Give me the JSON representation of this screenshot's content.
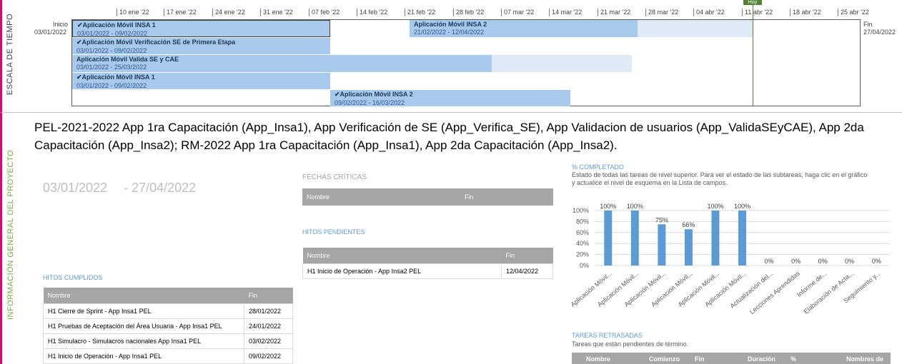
{
  "timeline": {
    "side_label": "ESCALA DE TIEMPO",
    "ticks": [
      "10 ene '22",
      "17 ene '22",
      "24 ene '22",
      "31 ene '22",
      "07 feb '22",
      "14 feb '22",
      "21 feb '22",
      "28 feb '22",
      "07 mar '22",
      "14 mar '22",
      "21 mar '22",
      "28 mar '22",
      "04 abr '22",
      "11 abr '22",
      "18 abr '22",
      "25 abr '22"
    ],
    "start_label": "Inicio",
    "start_date": "03/01/2022",
    "end_label": "Fin",
    "end_date": "27/04/2022",
    "today_label": "Hoy",
    "bars": [
      {
        "name": "✔Aplicación Móvil INSA 1",
        "dates": "03/01/2022 - 09/02/2022"
      },
      {
        "name": "Aplicación Móvil INSA 2",
        "dates": "21/02/2022 - 12/04/2022"
      },
      {
        "name": "✔Aplicación Móvil Verificación SE de Primera Etapa",
        "dates": "03/01/2022 - 09/02/2022"
      },
      {
        "name": "Aplicación Móvil Valida SE y CAE",
        "dates": "03/01/2022 - 25/03/2022"
      },
      {
        "name": "✔Aplicación Móvil INSA 1",
        "dates": "03/01/2022 - 09/02/2022"
      },
      {
        "name": "✔Aplicación Móvil INSA 2",
        "dates": "09/02/2022 - 16/03/2022"
      }
    ]
  },
  "info": {
    "side_label": "INFORMACIÓN GENERAL DEL PROYECTO",
    "description": "PEL-2021-2022 App 1ra Capacitación (App_Insa1), App Verificación de SE (App_Verifica_SE), App Validacion de usuarios (App_ValidaSEyCAE), App 2da Capacitación (App_Insa2); RM-2022 App 1ra Capacitación (App_Insa1), App 2da Capacitación (App_Insa2).",
    "date_start": "03/01/2022",
    "date_end": "- 27/04/2022"
  },
  "fechas_criticas": {
    "title": "FECHAS CRÍTICAS",
    "col_name": "Nombre",
    "col_end": "Fin"
  },
  "hitos_pendientes": {
    "title": "HITOS PENDIENTES",
    "col_name": "Nombre",
    "col_end": "Fin",
    "rows": [
      {
        "name": "H1 Inicio de Operación - App Insa2 PEL",
        "end": "12/04/2022"
      }
    ]
  },
  "hitos_cumplidos": {
    "title": "HITOS CUMPLIDOS",
    "col_name": "Nombre",
    "col_end": "Fin",
    "rows": [
      {
        "name": "H1 Cierre de Sprint - App Insa1 PEL",
        "end": "28/01/2022"
      },
      {
        "name": "H1 Pruebas de Aceptación del Área Usuaria - App Insa1 PEL",
        "end": "24/01/2022"
      },
      {
        "name": "H1 Simulacro - Simulacros nacionales App Insa1 PEL",
        "end": "03/02/2022"
      },
      {
        "name": "H1 Inicio de Operación - App Insa1 PEL",
        "end": "09/02/2022"
      }
    ]
  },
  "completado": {
    "title": "% COMPLETADO",
    "subtitle": "Estado de todas las tareas de nivel superior. Para ver el estado de las subtareas, haga clic en el gráfico y actualice el nivel de esquema en la Lista de campos."
  },
  "chart_data": {
    "type": "bar",
    "categories": [
      "Aplicación Móvil...",
      "Aplicación Móvil...",
      "Aplicación Móvil...",
      "Aplicación Móvil...",
      "Aplicación Móvil...",
      "Aplicación Móvil...",
      "Actualización del...",
      "Lecciones Aprendidas",
      "Informe de...",
      "Elaboración de Acta...",
      "Seguimiento y..."
    ],
    "values": [
      100,
      100,
      75,
      66,
      100,
      100,
      0,
      0,
      0,
      0,
      0
    ],
    "data_labels": [
      "100%",
      "100%",
      "75%",
      "66%",
      "100%",
      "100%",
      "0%",
      "0%",
      "0%",
      "0%",
      "0%"
    ],
    "y_ticks": [
      "0%",
      "20%",
      "40%",
      "60%",
      "80%",
      "100%"
    ],
    "ylim": [
      0,
      100
    ],
    "bar_color": "#5b9bd5",
    "grid": true
  },
  "tareas_retrasadas": {
    "title": "TAREAS RETRASADAS",
    "subtitle": "Tareas que están pendientes de término.",
    "columns": [
      "Nombre",
      "Comienzo",
      "Fin",
      "Duración",
      "%",
      "Nombres de"
    ]
  }
}
